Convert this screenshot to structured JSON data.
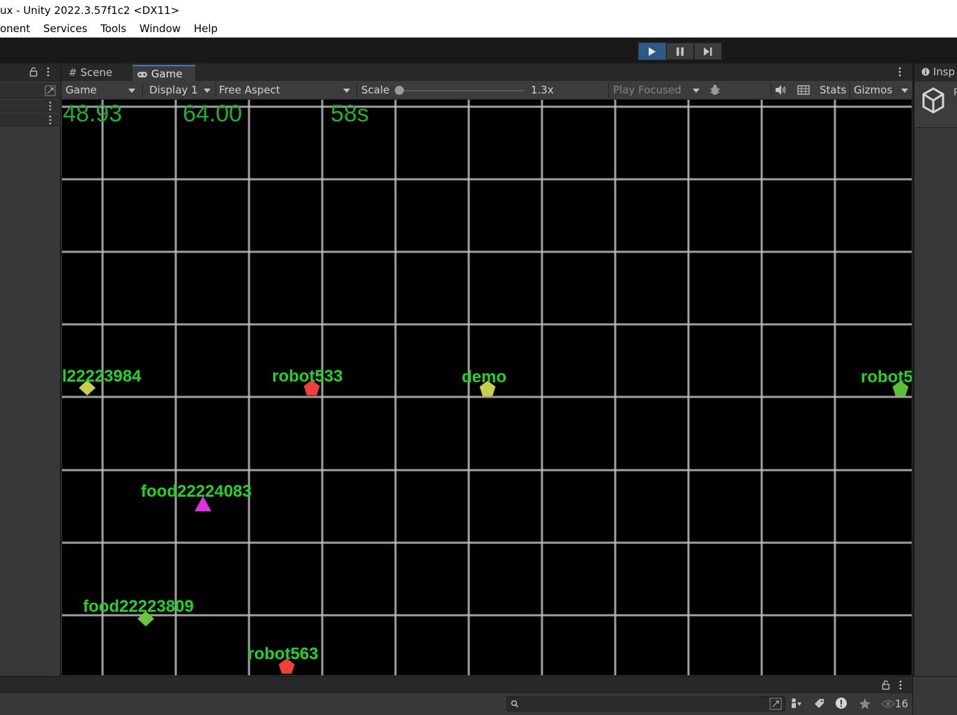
{
  "window": {
    "title": "ux - Unity 2022.3.57f1c2 <DX11>"
  },
  "menu": {
    "items": [
      "onent",
      "Services",
      "Tools",
      "Window",
      "Help"
    ]
  },
  "tabs": {
    "scene": "Scene",
    "game": "Game"
  },
  "game_toolbar": {
    "view_mode": "Game",
    "display": "Display 1",
    "aspect": "Free Aspect",
    "scale_label": "Scale",
    "scale_value": "1.3x",
    "play_mode": "Play Focused",
    "stats": "Stats",
    "gizmos": "Gizmos"
  },
  "hud": {
    "value1": "48.93",
    "value2": "64.00",
    "time": "58s"
  },
  "game_objects": [
    {
      "name": "l22223984",
      "color": "#c8cf4a",
      "shape": "diamond"
    },
    {
      "name": "robot533",
      "color": "#f0403a",
      "shape": "pentagon"
    },
    {
      "name": "demo",
      "color": "#c8cf4a",
      "shape": "pentagon"
    },
    {
      "name": "robot5",
      "color": "#5ac03a",
      "shape": "pentagon"
    },
    {
      "name": "food22224083",
      "color": "#e030e0",
      "shape": "triangle"
    },
    {
      "name": "food22223809",
      "color": "#6ac63a",
      "shape": "diamond"
    },
    {
      "name": "robot563",
      "color": "#f0403a",
      "shape": "pentagon"
    }
  ],
  "inspector": {
    "tab": "Insp"
  },
  "console": {
    "count": "16"
  },
  "colors": {
    "play_active": "#2c5a86",
    "label_green": "#21d426",
    "hud_green": "#1faf2f",
    "grid": "#bdbdbd"
  }
}
